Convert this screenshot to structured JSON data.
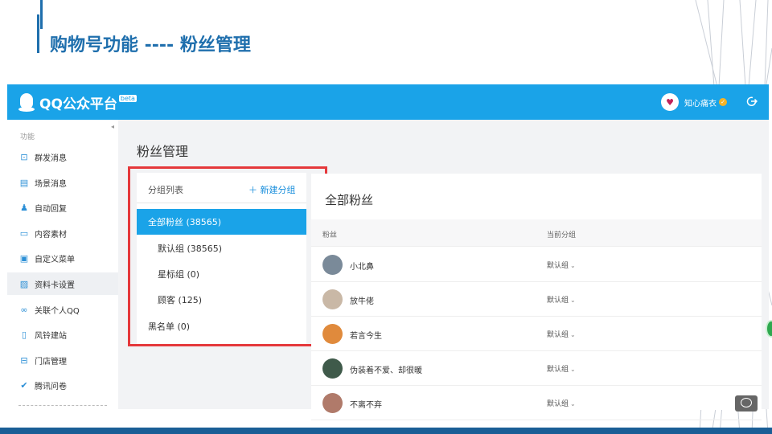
{
  "slide": {
    "title": "购物号功能 ----  粉丝管理"
  },
  "app": {
    "brand": "QQ公众平台",
    "brand_badge": "beta",
    "account_name": "知心痛衣",
    "accent_color": "#1aa3e8",
    "icons": {
      "verified": "verified-badge-icon",
      "logout": "logout-icon"
    }
  },
  "sidebar": {
    "section_title": "功能",
    "items": [
      {
        "label": "群发消息",
        "icon": "mass-message-icon"
      },
      {
        "label": "场景消息",
        "icon": "scene-message-icon"
      },
      {
        "label": "自动回复",
        "icon": "auto-reply-icon"
      },
      {
        "label": "内容素材",
        "icon": "content-material-icon"
      },
      {
        "label": "自定义菜单",
        "icon": "custom-menu-icon"
      },
      {
        "label": "资料卡设置",
        "icon": "profile-card-icon",
        "active": true
      },
      {
        "label": "关联个人QQ",
        "icon": "link-qq-icon"
      },
      {
        "label": "风铃建站",
        "icon": "site-builder-icon"
      },
      {
        "label": "门店管理",
        "icon": "store-icon"
      },
      {
        "label": "腾讯问卷",
        "icon": "survey-icon"
      }
    ]
  },
  "main": {
    "heading": "粉丝管理",
    "group_panel": {
      "title": "分组列表",
      "new_group": "新建分组",
      "groups": [
        {
          "label": "全部粉丝 (38565)",
          "active": true,
          "indent": false
        },
        {
          "label": "默认组 (38565)",
          "active": false,
          "indent": true
        },
        {
          "label": "星标组 (0)",
          "active": false,
          "indent": true
        },
        {
          "label": "顾客 (125)",
          "active": false,
          "indent": true
        },
        {
          "label": "黑名单 (0)",
          "active": false,
          "indent": false
        }
      ],
      "highlight_color": "#e5383b"
    },
    "fans_panel": {
      "title": "全部粉丝",
      "columns": [
        "粉丝",
        "当前分组"
      ],
      "rows": [
        {
          "name": "小北鼻",
          "group": "默认组",
          "avatar_color": "#7a8a99"
        },
        {
          "name": "放牛佬",
          "group": "默认组",
          "avatar_color": "#c9b8a6"
        },
        {
          "name": "若言今生",
          "group": "默认组",
          "avatar_color": "#e08a3c"
        },
        {
          "name": "伪装着不爱、却很暖",
          "group": "默认组",
          "avatar_color": "#3f5a4a"
        },
        {
          "name": "不离不弃",
          "group": "默认组",
          "avatar_color": "#b07a6a"
        }
      ]
    }
  }
}
